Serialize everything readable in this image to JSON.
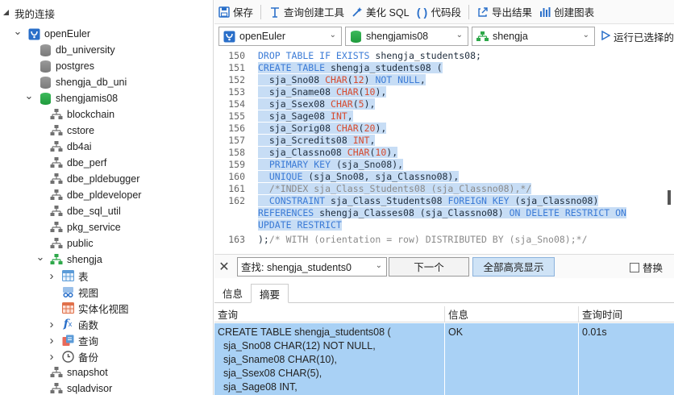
{
  "sidebar": {
    "root_label": "我的连接",
    "items": [
      {
        "label": "openEuler",
        "kind": "connection",
        "expanded": true
      },
      {
        "label": "db_university",
        "kind": "database"
      },
      {
        "label": "postgres",
        "kind": "database"
      },
      {
        "label": "shengja_db_uni",
        "kind": "database"
      },
      {
        "label": "shengjamis08",
        "kind": "database-active",
        "expanded": true
      },
      {
        "label": "blockchain",
        "kind": "schema"
      },
      {
        "label": "cstore",
        "kind": "schema"
      },
      {
        "label": "db4ai",
        "kind": "schema"
      },
      {
        "label": "dbe_perf",
        "kind": "schema"
      },
      {
        "label": "dbe_pldebugger",
        "kind": "schema"
      },
      {
        "label": "dbe_pldeveloper",
        "kind": "schema"
      },
      {
        "label": "dbe_sql_util",
        "kind": "schema"
      },
      {
        "label": "pkg_service",
        "kind": "schema"
      },
      {
        "label": "public",
        "kind": "schema"
      },
      {
        "label": "shengja",
        "kind": "schema-active",
        "expanded": true
      },
      {
        "label": "表",
        "kind": "tables"
      },
      {
        "label": "视图",
        "kind": "views"
      },
      {
        "label": "实体化视图",
        "kind": "matviews"
      },
      {
        "label": "函数",
        "kind": "functions"
      },
      {
        "label": "查询",
        "kind": "queries"
      },
      {
        "label": "备份",
        "kind": "backups"
      },
      {
        "label": "snapshot",
        "kind": "schema"
      },
      {
        "label": "sqladvisor",
        "kind": "schema"
      }
    ]
  },
  "toolbar": {
    "save": "保存",
    "query_builder": "查询创建工具",
    "beautify": "美化 SQL",
    "snippet": "代码段",
    "export": "导出结果",
    "create_chart": "创建图表"
  },
  "selectors": {
    "connection": "openEuler",
    "database": "shengjamis08",
    "schema": "shengja",
    "run": "运行已选择的"
  },
  "editor": {
    "lines": [
      {
        "n": "150",
        "segments": [
          [
            "kw",
            "DROP TABLE IF EXISTS "
          ],
          [
            "tx",
            "shengja_students08;"
          ]
        ],
        "hl": false
      },
      {
        "n": "151",
        "segments": [
          [
            "kw",
            "CREATE TABLE "
          ],
          [
            "tx",
            "shengja_students08 ("
          ]
        ],
        "hl": true
      },
      {
        "n": "152",
        "segments": [
          [
            "tx",
            "  sja_Sno08 "
          ],
          [
            "ty",
            "CHAR"
          ],
          [
            "tx",
            "("
          ],
          [
            "ty",
            "12"
          ],
          [
            "tx",
            ") "
          ],
          [
            "kw",
            "NOT NULL"
          ],
          [
            "tx",
            ","
          ]
        ],
        "hl": true
      },
      {
        "n": "153",
        "segments": [
          [
            "tx",
            "  sja_Sname08 "
          ],
          [
            "ty",
            "CHAR"
          ],
          [
            "tx",
            "("
          ],
          [
            "ty",
            "10"
          ],
          [
            "tx",
            "),"
          ]
        ],
        "hl": true
      },
      {
        "n": "154",
        "segments": [
          [
            "tx",
            "  sja_Ssex08 "
          ],
          [
            "ty",
            "CHAR"
          ],
          [
            "tx",
            "("
          ],
          [
            "ty",
            "5"
          ],
          [
            "tx",
            "),"
          ]
        ],
        "hl": true
      },
      {
        "n": "155",
        "segments": [
          [
            "tx",
            "  sja_Sage08 "
          ],
          [
            "ty",
            "INT"
          ],
          [
            "tx",
            ","
          ]
        ],
        "hl": true
      },
      {
        "n": "156",
        "segments": [
          [
            "tx",
            "  sja_Sorig08 "
          ],
          [
            "ty",
            "CHAR"
          ],
          [
            "tx",
            "("
          ],
          [
            "ty",
            "20"
          ],
          [
            "tx",
            "),"
          ]
        ],
        "hl": true
      },
      {
        "n": "157",
        "segments": [
          [
            "tx",
            "  sja_Scredits08 "
          ],
          [
            "ty",
            "INT"
          ],
          [
            "tx",
            ","
          ]
        ],
        "hl": true
      },
      {
        "n": "158",
        "segments": [
          [
            "tx",
            "  sja_Classno08 "
          ],
          [
            "ty",
            "CHAR"
          ],
          [
            "tx",
            "("
          ],
          [
            "ty",
            "10"
          ],
          [
            "tx",
            "),"
          ]
        ],
        "hl": true
      },
      {
        "n": "159",
        "segments": [
          [
            "tx",
            "  "
          ],
          [
            "kw",
            "PRIMARY KEY "
          ],
          [
            "tx",
            "(sja_Sno08),"
          ]
        ],
        "hl": true
      },
      {
        "n": "160",
        "segments": [
          [
            "tx",
            "  "
          ],
          [
            "kw",
            "UNIQUE "
          ],
          [
            "tx",
            "(sja_Sno08, sja_Classno08),"
          ]
        ],
        "hl": true
      },
      {
        "n": "161",
        "segments": [
          [
            "cm",
            "  /*INDEX sja_Class_Students08 (sja_Classno08),*/"
          ]
        ],
        "hl": true
      },
      {
        "n": "162",
        "segments": [
          [
            "tx",
            "  "
          ],
          [
            "kw",
            "CONSTRAINT "
          ],
          [
            "tx",
            "sja_Class_Students08 "
          ],
          [
            "kw",
            "FOREIGN KEY "
          ],
          [
            "tx",
            "(sja_Classno08)"
          ]
        ],
        "hl": true
      },
      {
        "n": "",
        "segments": [
          [
            "kw",
            "REFERENCES "
          ],
          [
            "tx",
            "shengja_Classes08 (sja_Classno08) "
          ],
          [
            "kw",
            "ON DELETE RESTRICT ON"
          ]
        ],
        "hl": true
      },
      {
        "n": "",
        "segments": [
          [
            "kw",
            "UPDATE RESTRICT"
          ]
        ],
        "hl": true
      },
      {
        "n": "163",
        "segments": [
          [
            "tx",
            ");"
          ],
          [
            "cm",
            "/* WITH (orientation = row) DISTRIBUTED BY (sja_Sno08);*/"
          ]
        ],
        "hl": false
      }
    ]
  },
  "findbar": {
    "query": "查找: shengja_students0",
    "next": "下一个",
    "highlight_all": "全部高亮显示",
    "replace": "替换"
  },
  "tabs": [
    "信息",
    "摘要"
  ],
  "results": {
    "headers": [
      "查询",
      "信息",
      "查询时间"
    ],
    "row": {
      "query": "CREATE TABLE shengja_students08 (\n  sja_Sno08 CHAR(12) NOT NULL,\n  sja_Sname08 CHAR(10),\n  sja_Ssex08 CHAR(5),\n  sja_Sage08 INT,",
      "info": "OK",
      "time": "0.01s"
    }
  },
  "colors": {
    "keyword": "#3b7bd6",
    "type": "#d64b2f",
    "comment": "#8a8a8a",
    "selection": "#c7ddf5",
    "result_row": "#a9d1f5"
  }
}
